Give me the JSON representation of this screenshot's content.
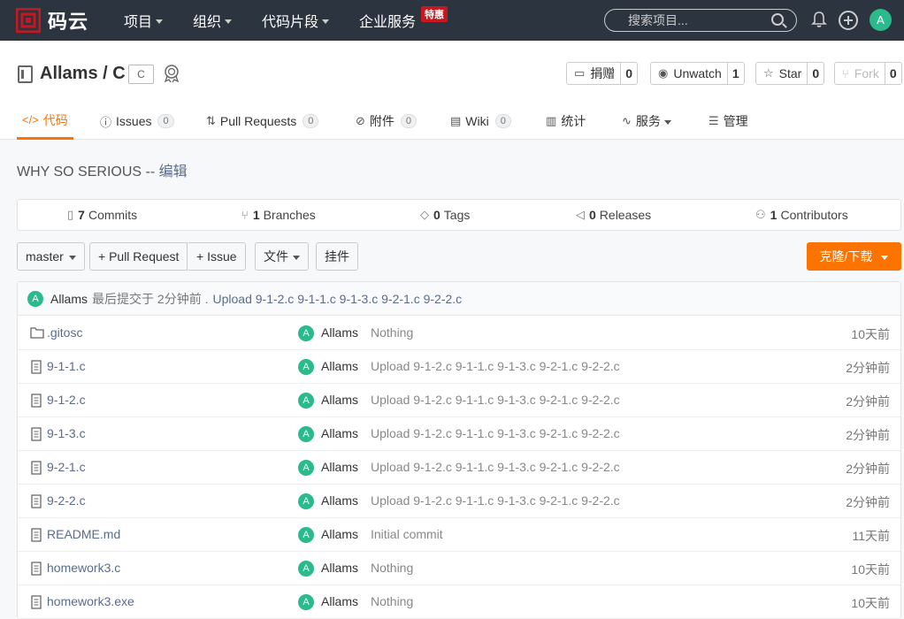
{
  "topbar": {
    "logo_text": "码云",
    "nav": [
      {
        "label": "项目",
        "dropdown": true
      },
      {
        "label": "组织",
        "dropdown": true
      },
      {
        "label": "代码片段",
        "dropdown": true
      },
      {
        "label": "企业服务",
        "dropdown": false
      }
    ],
    "promo_badge": "特惠",
    "search_placeholder": "搜索项目...",
    "avatar_letter": "A"
  },
  "repo": {
    "owner": "Allams",
    "separator": "/",
    "name": "C",
    "language_tag": "C",
    "description": "WHY SO SERIOUS",
    "description_sep": " -- ",
    "edit_label": "编辑"
  },
  "actions": {
    "donate": {
      "label": "捐赠",
      "count": "0"
    },
    "watch": {
      "label": "Unwatch",
      "count": "1"
    },
    "star": {
      "label": "Star",
      "count": "0"
    },
    "fork": {
      "label": "Fork",
      "count": "0"
    }
  },
  "tabs": [
    {
      "label": "代码",
      "icon": "code-icon"
    },
    {
      "label": "Issues",
      "count": "0",
      "icon": "issue-icon"
    },
    {
      "label": "Pull Requests",
      "count": "0",
      "icon": "pull-request-icon"
    },
    {
      "label": "附件",
      "count": "0",
      "icon": "attachment-icon"
    },
    {
      "label": "Wiki",
      "count": "0",
      "icon": "wiki-icon"
    },
    {
      "label": "统计",
      "icon": "stats-icon"
    },
    {
      "label": "服务",
      "icon": "service-icon"
    },
    {
      "label": "管理",
      "icon": "manage-icon"
    }
  ],
  "stats": {
    "commits": {
      "count": "7",
      "label": "Commits"
    },
    "branches": {
      "count": "1",
      "label": "Branches"
    },
    "tags": {
      "count": "0",
      "label": "Tags"
    },
    "releases": {
      "count": "0",
      "label": "Releases"
    },
    "contributors": {
      "count": "1",
      "label": "Contributors"
    }
  },
  "toolbar": {
    "branch": "master",
    "pull_request": "+ Pull Request",
    "issue": "+ Issue",
    "file": "文件",
    "widget": "挂件",
    "clone": "克隆/下载"
  },
  "last_commit": {
    "author": "Allams",
    "meta": "最后提交于 2分钟前 .",
    "message": "Upload 9-1-2.c 9-1-1.c 9-1-3.c 9-2-1.c 9-2-2.c"
  },
  "files": [
    {
      "name": ".gitosc",
      "type": "folder",
      "author": "Allams",
      "message": "Nothing",
      "time": "10天前"
    },
    {
      "name": "9-1-1.c",
      "type": "file",
      "author": "Allams",
      "message": "Upload 9-1-2.c 9-1-1.c 9-1-3.c 9-2-1.c 9-2-2.c",
      "time": "2分钟前"
    },
    {
      "name": "9-1-2.c",
      "type": "file",
      "author": "Allams",
      "message": "Upload 9-1-2.c 9-1-1.c 9-1-3.c 9-2-1.c 9-2-2.c",
      "time": "2分钟前"
    },
    {
      "name": "9-1-3.c",
      "type": "file",
      "author": "Allams",
      "message": "Upload 9-1-2.c 9-1-1.c 9-1-3.c 9-2-1.c 9-2-2.c",
      "time": "2分钟前"
    },
    {
      "name": "9-2-1.c",
      "type": "file",
      "author": "Allams",
      "message": "Upload 9-1-2.c 9-1-1.c 9-1-3.c 9-2-1.c 9-2-2.c",
      "time": "2分钟前"
    },
    {
      "name": "9-2-2.c",
      "type": "file",
      "author": "Allams",
      "message": "Upload 9-1-2.c 9-1-1.c 9-1-3.c 9-2-1.c 9-2-2.c",
      "time": "2分钟前"
    },
    {
      "name": "README.md",
      "type": "file",
      "author": "Allams",
      "message": "Initial commit",
      "time": "11天前"
    },
    {
      "name": "homework3.c",
      "type": "file",
      "author": "Allams",
      "message": "Nothing",
      "time": "10天前"
    },
    {
      "name": "homework3.exe",
      "type": "file",
      "author": "Allams",
      "message": "Nothing",
      "time": "10天前"
    }
  ],
  "colors": {
    "topbar": "#2c3440",
    "accent": "#fe7300",
    "avatar": "#2aba8b",
    "logo_red": "#c8181f"
  }
}
